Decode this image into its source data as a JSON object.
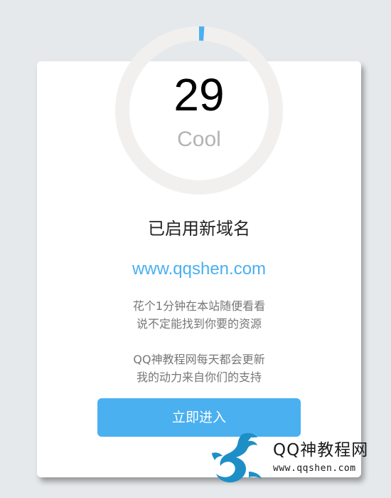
{
  "countdown": {
    "value": "29",
    "label": "Cool",
    "progress_fraction": 0.01
  },
  "card": {
    "heading": "已启用新域名",
    "domain": "www.qqshen.com",
    "paragraph1_line1": "花个1分钟在本站随便看看",
    "paragraph1_line2": "说不定能找到你要的资源",
    "paragraph2_line1": "QQ神教程网每天都会更新",
    "paragraph2_line2": "我的动力来自你们的支持",
    "enter_button": "立即进入"
  },
  "watermark": {
    "title": "QQ神教程网",
    "url": "www.qqshen.com"
  },
  "colors": {
    "accent": "#4ab0f0",
    "ring_track": "#f1f0ef",
    "background": "#e6e9eb",
    "dragon": "#1e8fc6"
  },
  "icons": {
    "logo": "dragon-logo-icon"
  }
}
